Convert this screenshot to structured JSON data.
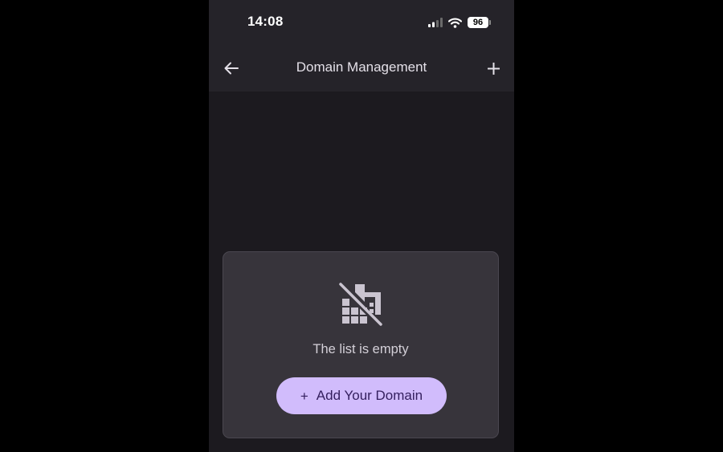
{
  "status_bar": {
    "time": "14:08",
    "battery_level": "96",
    "icons": [
      "cellular-signal-icon",
      "wifi-icon",
      "battery-icon"
    ]
  },
  "app_bar": {
    "title": "Domain Management",
    "back_icon": "arrow-left-icon",
    "add_icon": "plus-icon"
  },
  "empty_state": {
    "icon": "domain-disabled-icon",
    "message": "The list is empty",
    "button_icon": "+",
    "button_label": "Add Your Domain"
  },
  "colors": {
    "background": "#1c1a1f",
    "app_bar": "#252329",
    "card": "#37343b",
    "accent": "#d1bcfc",
    "accent_text": "#35205f",
    "icon": "#cac4d0"
  }
}
